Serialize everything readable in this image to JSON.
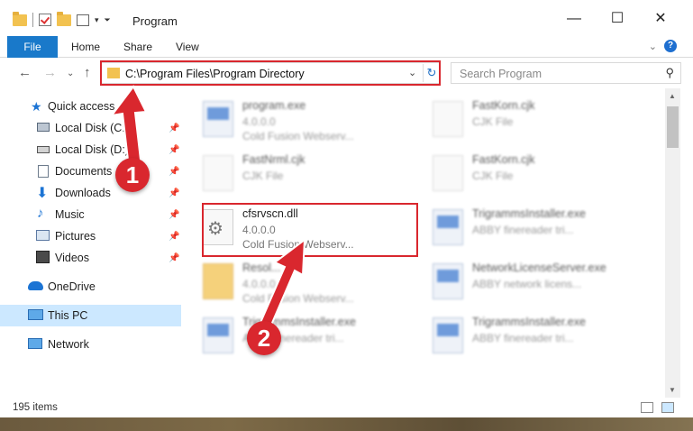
{
  "window": {
    "title": "Program",
    "minimize": "—",
    "maximize": "☐",
    "close": "✕"
  },
  "ribbon": {
    "file": "File",
    "home": "Home",
    "share": "Share",
    "view": "View",
    "help": "?"
  },
  "address": {
    "path": "C:\\Program Files\\Program Directory"
  },
  "search": {
    "placeholder": "Search Program"
  },
  "sidebar": {
    "quick_access": "Quick access",
    "items": [
      {
        "label": "Local Disk (C:)",
        "icon": "drive-icon"
      },
      {
        "label": "Local Disk (D:)",
        "icon": "drive-icon"
      },
      {
        "label": "Documents",
        "icon": "documents-icon"
      },
      {
        "label": "Downloads",
        "icon": "downloads-icon"
      },
      {
        "label": "Music",
        "icon": "music-icon"
      },
      {
        "label": "Pictures",
        "icon": "pictures-icon"
      },
      {
        "label": "Videos",
        "icon": "videos-icon"
      }
    ],
    "onedrive": "OneDrive",
    "this_pc": "This PC",
    "network": "Network"
  },
  "files": [
    {
      "name": "program.exe",
      "line1": "4.0.0.0",
      "line2": "Cold Fusion Webserv...",
      "icon": "app"
    },
    {
      "name": "FastKorn.cjk",
      "line1": "CJK File",
      "line2": "",
      "icon": "doc"
    },
    {
      "name": "FastNrml.cjk",
      "line1": "CJK File",
      "line2": "",
      "icon": "doc"
    },
    {
      "name": "FastKorn.cjk",
      "line1": "CJK File",
      "line2": "",
      "icon": "doc"
    },
    {
      "name": "cfsrvscn.dll",
      "line1": "4.0.0.0",
      "line2": "Cold Fusion Webserv...",
      "icon": "dll"
    },
    {
      "name": "TrigrammsInstaller.exe",
      "line1": "ABBY finereader tri...",
      "line2": "",
      "icon": "app"
    },
    {
      "name": "Resol...",
      "line1": "4.0.0.0",
      "line2": "Cold Fusion Webserv...",
      "icon": "folder"
    },
    {
      "name": "NetworkLicenseServer.exe",
      "line1": "ABBY network licens...",
      "line2": "",
      "icon": "app"
    },
    {
      "name": "TrigrammsInstaller.exe",
      "line1": "ABBY finereader tri...",
      "line2": "",
      "icon": "app"
    },
    {
      "name": "TrigrammsInstaller.exe",
      "line1": "ABBY finereader tri...",
      "line2": "",
      "icon": "app"
    }
  ],
  "status": {
    "count": "195 items"
  },
  "annotations": {
    "step1": "1",
    "step2": "2",
    "color": "#d9272e"
  }
}
